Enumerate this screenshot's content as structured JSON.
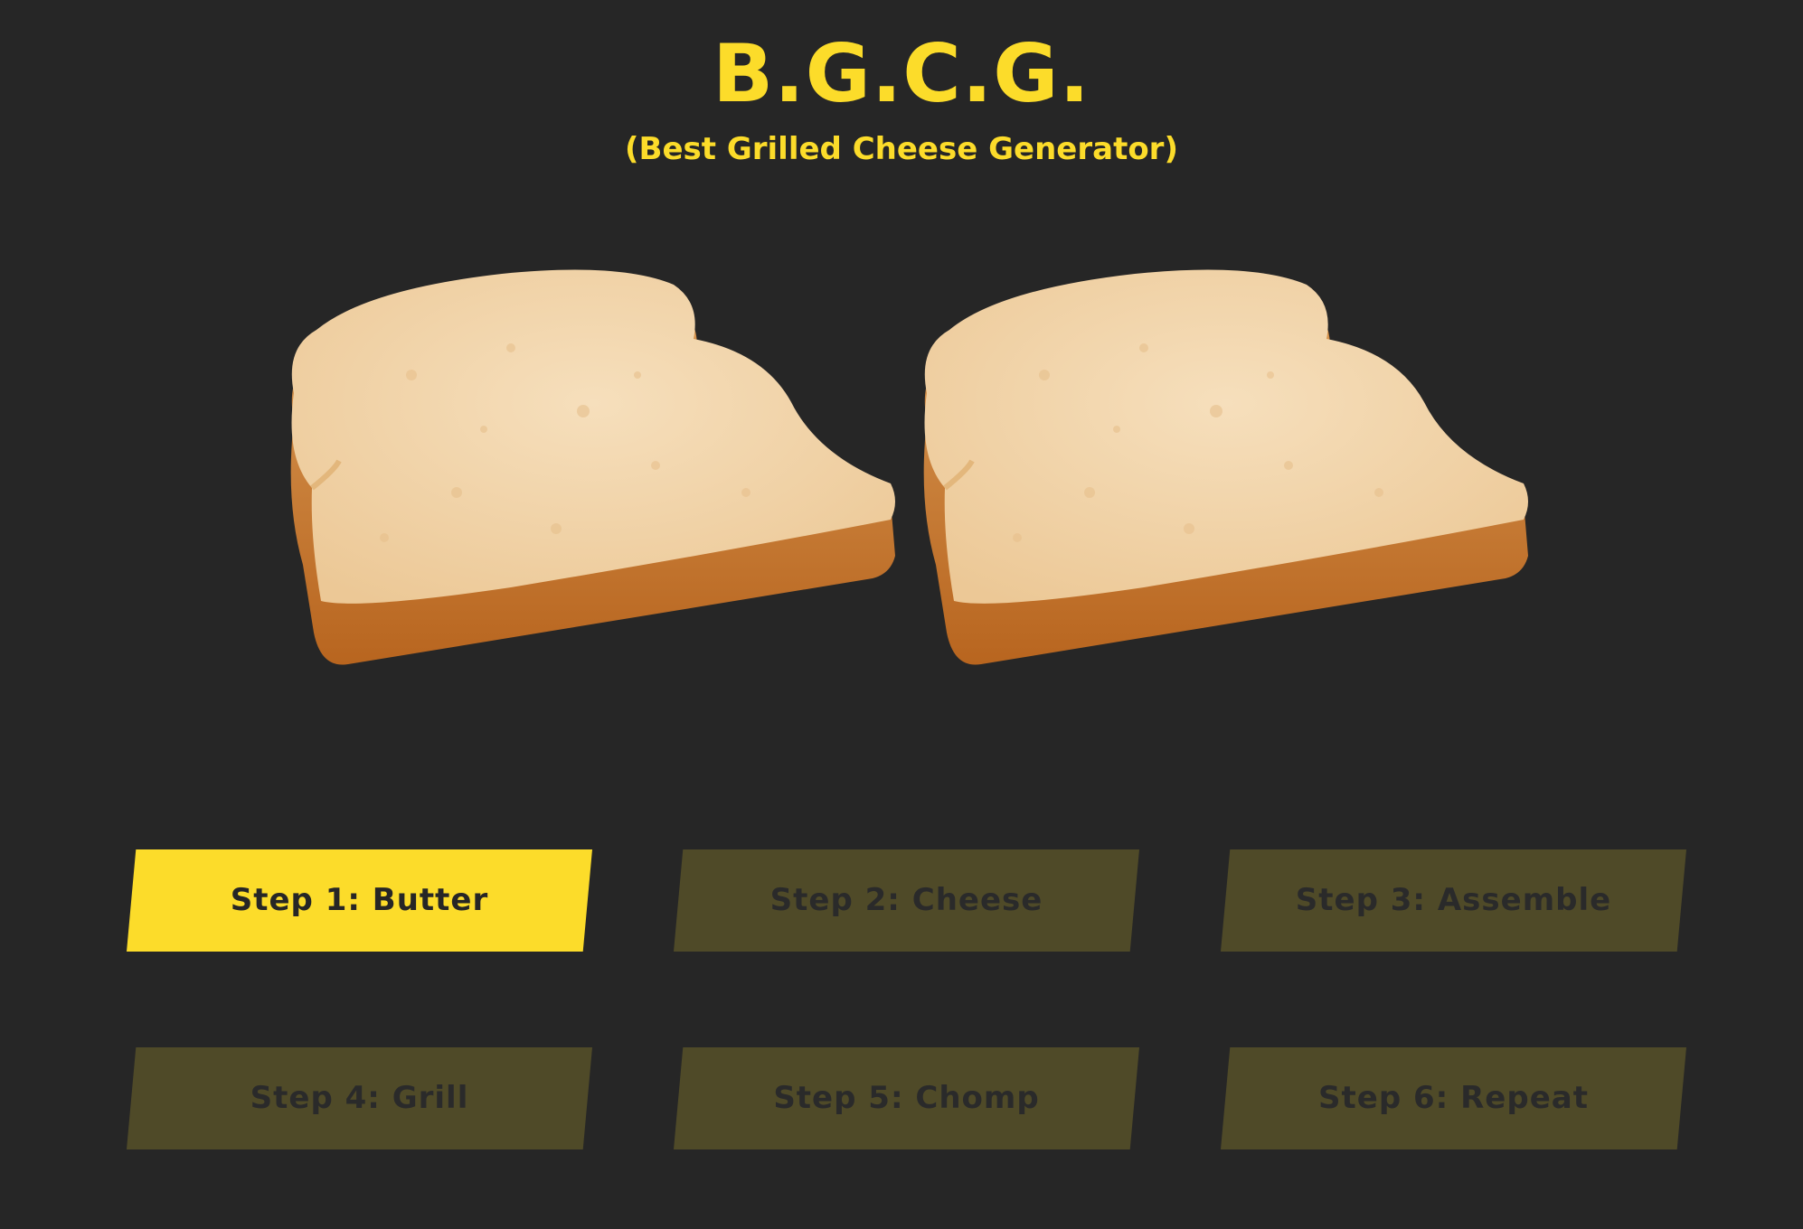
{
  "header": {
    "title": "B.G.C.G.",
    "subtitle": "(Best Grilled Cheese Generator)"
  },
  "images": [
    {
      "name": "bread-slice-left",
      "alt": "slice of bread"
    },
    {
      "name": "bread-slice-right",
      "alt": "slice of bread"
    }
  ],
  "steps": [
    {
      "label": "Step 1: Butter",
      "active": true
    },
    {
      "label": "Step 2: Cheese",
      "active": false
    },
    {
      "label": "Step 3: Assemble",
      "active": false
    },
    {
      "label": "Step 4: Grill",
      "active": false
    },
    {
      "label": "Step 5: Chomp",
      "active": false
    },
    {
      "label": "Step 6: Repeat",
      "active": false
    }
  ],
  "colors": {
    "background": "#262626",
    "accent": "#fcdc2a",
    "inactive_button": "#4f4a28"
  }
}
